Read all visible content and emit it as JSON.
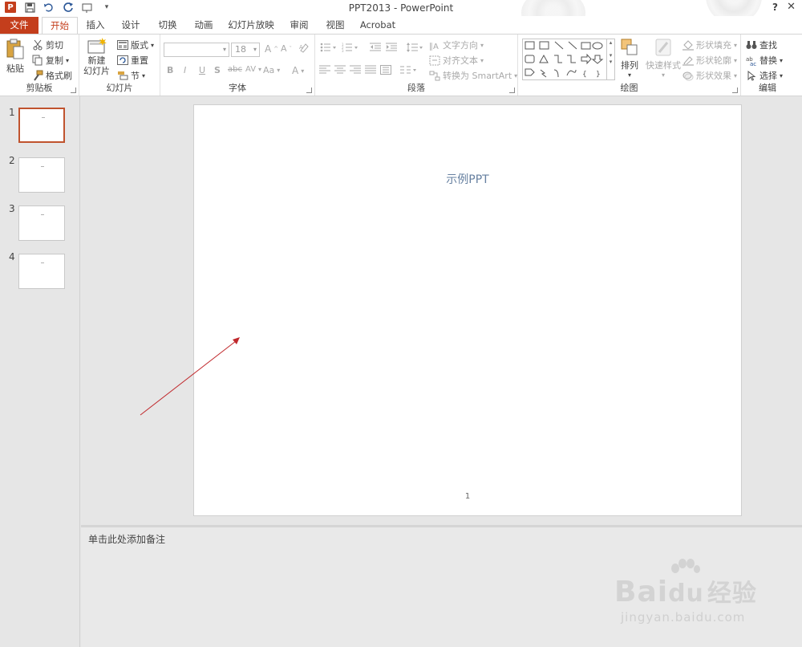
{
  "window": {
    "title": "PPT2013 - PowerPoint",
    "logo_letter": "P",
    "help": "?",
    "close": "✕"
  },
  "tabs": [
    {
      "label": "文件"
    },
    {
      "label": "开始"
    },
    {
      "label": "插入"
    },
    {
      "label": "设计"
    },
    {
      "label": "切换"
    },
    {
      "label": "动画"
    },
    {
      "label": "幻灯片放映"
    },
    {
      "label": "审阅"
    },
    {
      "label": "视图"
    },
    {
      "label": "Acrobat"
    }
  ],
  "ribbon": {
    "clipboard": {
      "label": "剪贴板",
      "paste": "粘贴",
      "cut": "剪切",
      "copy": "复制",
      "format_painter": "格式刷"
    },
    "slides": {
      "label": "幻灯片",
      "new_slide_line1": "新建",
      "new_slide_line2": "幻灯片",
      "layout": "版式",
      "reset": "重置",
      "section": "节"
    },
    "font": {
      "label": "字体",
      "font_name": "",
      "font_size": "18",
      "bold": "B",
      "italic": "I",
      "underline": "U",
      "shadow": "S",
      "strike": "abc",
      "spacing": "AV",
      "case": "Aa",
      "color": "A"
    },
    "paragraph": {
      "label": "段落",
      "text_direction": "文字方向",
      "align_text": "对齐文本",
      "convert_smartart": "转换为 SmartArt"
    },
    "drawing": {
      "label": "绘图",
      "arrange": "排列",
      "quick_styles": "快速样式",
      "shape_fill": "形状填充",
      "shape_outline": "形状轮廓",
      "shape_effects": "形状效果"
    },
    "editing": {
      "label": "编辑",
      "find": "查找",
      "replace": "替换",
      "select": "选择"
    }
  },
  "thumbnails": [
    {
      "num": "1",
      "selected": true
    },
    {
      "num": "2",
      "selected": false
    },
    {
      "num": "3",
      "selected": false
    },
    {
      "num": "4",
      "selected": false
    }
  ],
  "slide": {
    "title": "示例PPT",
    "page_number": "1"
  },
  "notes": {
    "placeholder": "单击此处添加备注"
  },
  "watermark": {
    "brand": "Bai",
    "brand2": "du",
    "cn": "经验",
    "url": "jingyan.baidu.com"
  },
  "colors": {
    "accent": "#c43e1c",
    "slide_title": "#6680a0",
    "arrow": "#c0282c"
  }
}
